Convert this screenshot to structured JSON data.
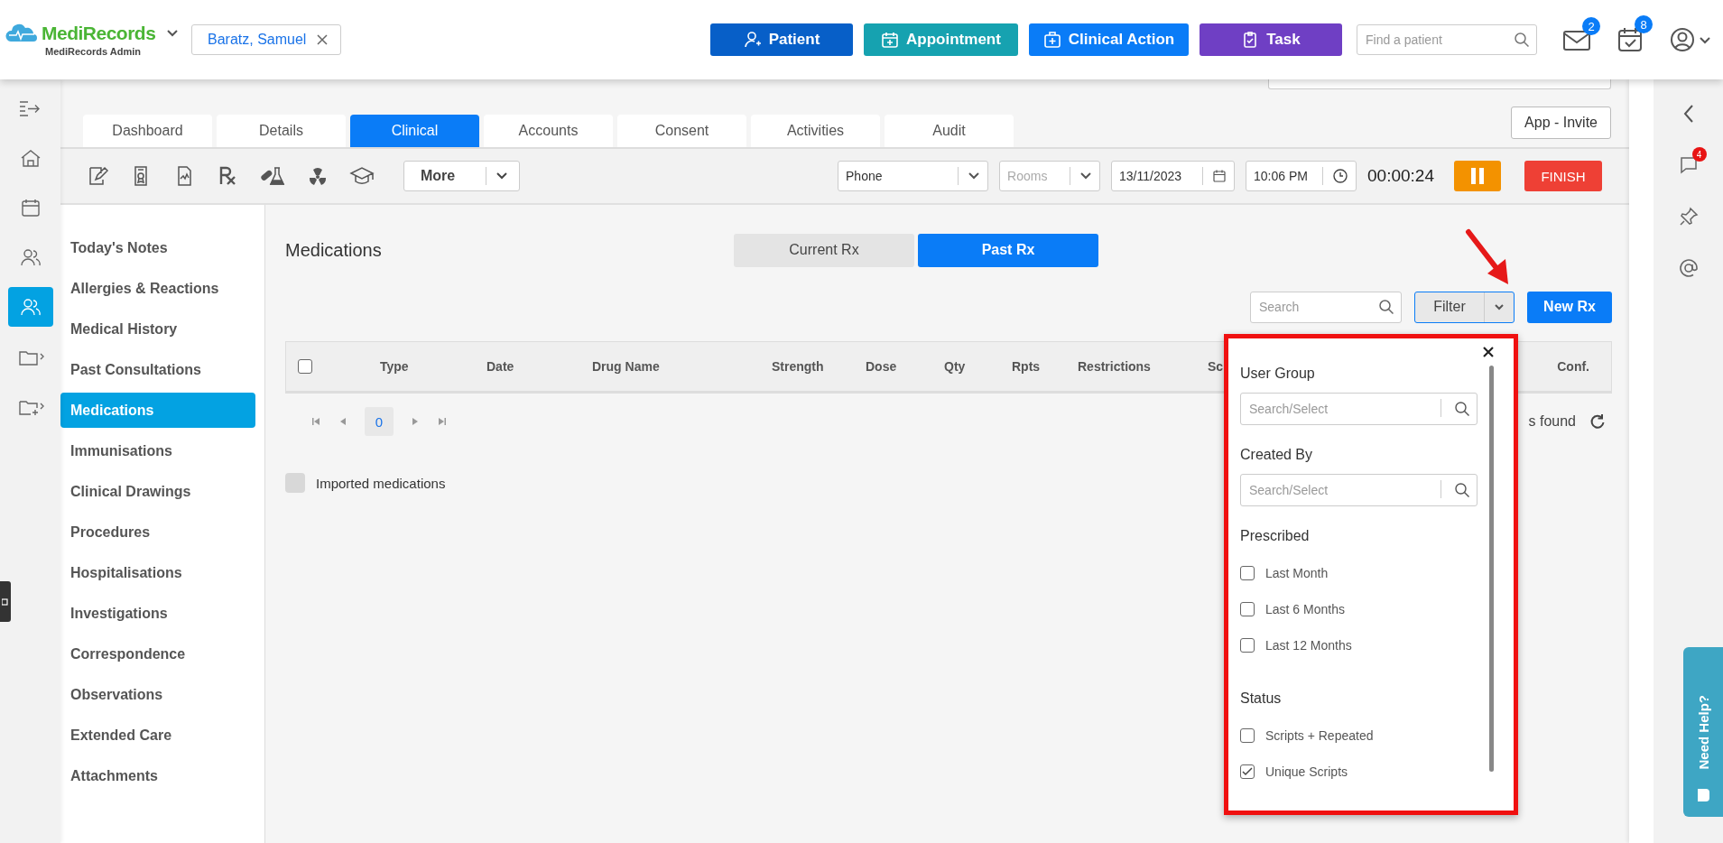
{
  "header": {
    "logo": "MediRecords",
    "logo_subtitle": "MediRecords Admin",
    "patient_chip": "Baratz, Samuel",
    "actions": [
      {
        "label": "Patient",
        "kind": "patient",
        "color": "#075fc8"
      },
      {
        "label": "Appointment",
        "kind": "appointment",
        "color": "#16a2b0"
      },
      {
        "label": "Clinical Action",
        "kind": "clinical",
        "color": "#0a7cf7"
      },
      {
        "label": "Task",
        "kind": "task",
        "color": "#6f3fc4"
      }
    ],
    "search": {
      "placeholder": "Find a patient"
    },
    "mail_badge": "2",
    "tasks_badge": "8"
  },
  "nav_rail": [
    {
      "kind": "collapse",
      "selected": false
    },
    {
      "kind": "home",
      "selected": false
    },
    {
      "kind": "calendar",
      "selected": false
    },
    {
      "kind": "people",
      "selected": false
    },
    {
      "kind": "people",
      "selected": true
    },
    {
      "kind": "folder",
      "selected": false
    },
    {
      "kind": "folder-add",
      "selected": false
    }
  ],
  "tabs": [
    {
      "label": "Dashboard",
      "selected": false
    },
    {
      "label": "Details",
      "selected": false
    },
    {
      "label": "Clinical",
      "selected": true
    },
    {
      "label": "Accounts",
      "selected": false
    },
    {
      "label": "Consent",
      "selected": false
    },
    {
      "label": "Activities",
      "selected": false
    },
    {
      "label": "Audit",
      "selected": false
    }
  ],
  "app_invite": "App - Invite",
  "toolbar": {
    "more": "More",
    "channel": "Phone",
    "room": {
      "placeholder": "Rooms"
    },
    "date": "13/11/2023",
    "time": "10:06 PM",
    "timer": "00:00:24",
    "finish": "FINISH"
  },
  "clinical_nav": [
    {
      "label": "Today's Notes",
      "selected": false
    },
    {
      "label": "Allergies & Reactions",
      "selected": false
    },
    {
      "label": "Medical History",
      "selected": false
    },
    {
      "label": "Past Consultations",
      "selected": false
    },
    {
      "label": "Medications",
      "selected": true
    },
    {
      "label": "Immunisations",
      "selected": false
    },
    {
      "label": "Clinical Drawings",
      "selected": false
    },
    {
      "label": "Procedures",
      "selected": false
    },
    {
      "label": "Hospitalisations",
      "selected": false
    },
    {
      "label": "Investigations",
      "selected": false
    },
    {
      "label": "Correspondence",
      "selected": false
    },
    {
      "label": "Observations",
      "selected": false
    },
    {
      "label": "Extended Care",
      "selected": false
    },
    {
      "label": "Attachments",
      "selected": false
    }
  ],
  "content": {
    "title": "Medications",
    "rx_tabs": [
      {
        "label": "Current Rx",
        "selected": false
      },
      {
        "label": "Past Rx",
        "selected": true
      }
    ],
    "search": {
      "placeholder": "Search"
    },
    "filter": "Filter",
    "new_rx": "New Rx",
    "table": {
      "select_all": false,
      "columns": [
        "Type",
        "Date",
        "Drug Name",
        "Strength",
        "Dose",
        "Qty",
        "Rpts",
        "Restrictions",
        "Sc",
        "Conf."
      ]
    },
    "pager": {
      "page": "0"
    },
    "records_text": "s found",
    "imported": {
      "label": "Imported medications",
      "checked": false
    }
  },
  "filter_panel": {
    "sections": [
      {
        "title": "User Group",
        "kind": "search",
        "placeholder": "Search/Select"
      },
      {
        "title": "Created By",
        "kind": "search",
        "placeholder": "Search/Select"
      },
      {
        "title": "Prescribed",
        "kind": "checks",
        "options": [
          {
            "label": "Last Month",
            "checked": false
          },
          {
            "label": "Last 6 Months",
            "checked": false
          },
          {
            "label": "Last 12 Months",
            "checked": false
          }
        ]
      },
      {
        "title": "Status",
        "kind": "checks",
        "options": [
          {
            "label": "Scripts + Repeated",
            "checked": false
          },
          {
            "label": "Unique Scripts",
            "checked": true
          }
        ]
      }
    ]
  },
  "right_rail": {
    "chat_badge": "4"
  },
  "help_tab": "Need Help?"
}
